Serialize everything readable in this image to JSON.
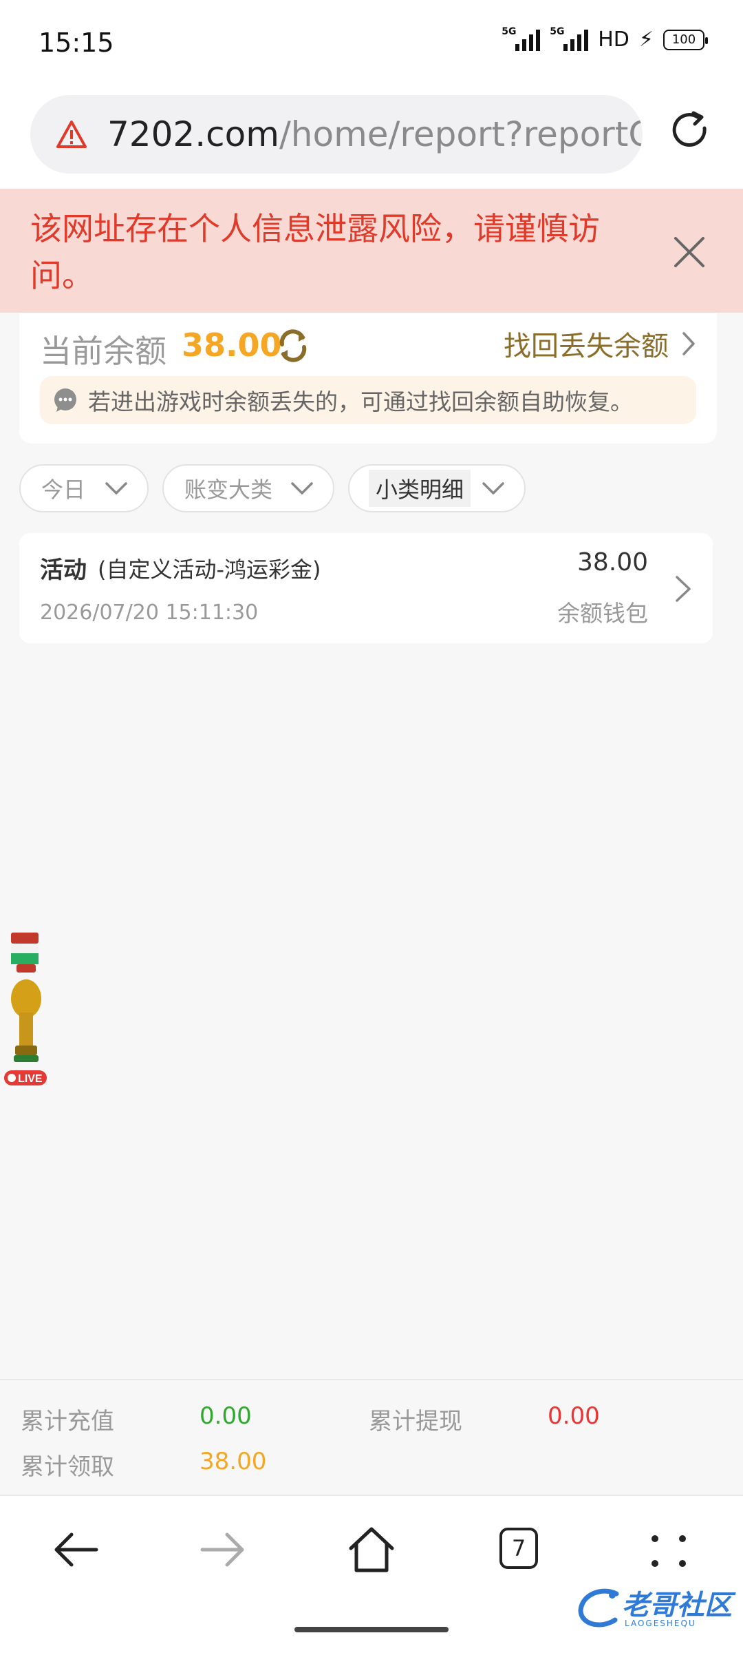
{
  "status_bar": {
    "time": "15:15",
    "signal_1": "5G",
    "signal_2": "5G",
    "hd": "HD",
    "battery": "100"
  },
  "browser": {
    "url_domain": "7202.com",
    "url_path": "/home/report?reportCt"
  },
  "warning": {
    "text": "该网址存在个人信息泄露风险，请谨慎访问。"
  },
  "balance": {
    "label": "当前余额",
    "amount": "38.00",
    "recover_label": "找回丢失余额",
    "hint": "若进出游戏时余额丢失的，可通过找回余额自助恢复。"
  },
  "filters": [
    {
      "label": "今日"
    },
    {
      "label": "账变大类"
    },
    {
      "label": "小类明细"
    }
  ],
  "records": [
    {
      "type": "活动",
      "detail": "(自定义活动-鸿运彩金)",
      "time": "2026/07/20 15:11:30",
      "amount": "38.00",
      "wallet": "余额钱包"
    }
  ],
  "summary": {
    "recharge_label": "累计充值",
    "recharge_value": "0.00",
    "withdraw_label": "累计提现",
    "withdraw_value": "0.00",
    "claim_label": "累计领取",
    "claim_value": "38.00"
  },
  "float_widget": {
    "live_label": "LIVE"
  },
  "bottom_nav": {
    "tab_count": "7"
  },
  "watermark": {
    "text": "老哥社区",
    "sub": "LAOGESHEQU"
  },
  "colors": {
    "accent_orange": "#f5a623",
    "warning_red": "#e03a2a",
    "green": "#2ea92e",
    "red": "#ee3333"
  }
}
